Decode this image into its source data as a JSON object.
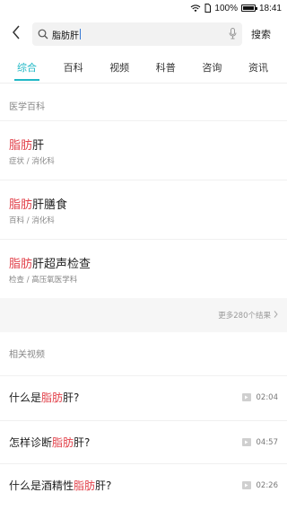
{
  "status_bar": {
    "battery_percent": "100%",
    "time": "18:41",
    "wifi_icon": "wifi-icon",
    "sim_icon": "sim-icon",
    "battery_level": 1.0
  },
  "search": {
    "value_highlight": "脂肪",
    "value_rest": "肝",
    "action_label": "搜索",
    "icons": [
      "back-arrow-icon",
      "search-icon",
      "microphone-icon"
    ]
  },
  "tabs": [
    {
      "label": "综合",
      "active": true
    },
    {
      "label": "百科",
      "active": false
    },
    {
      "label": "视频",
      "active": false
    },
    {
      "label": "科普",
      "active": false
    },
    {
      "label": "咨询",
      "active": false
    },
    {
      "label": "资讯",
      "active": false
    }
  ],
  "encyclopedia": {
    "header": "医学百科",
    "results": [
      {
        "title_highlight": "脂肪",
        "title_rest": "肝",
        "subtitle": "症状 / 消化科"
      },
      {
        "title_highlight": "脂肪",
        "title_rest": "肝膳食",
        "subtitle": "百科 / 消化科"
      },
      {
        "title_highlight": "脂肪",
        "title_rest": "肝超声检查",
        "subtitle": "检查 / 高压氧医学科"
      }
    ],
    "more_label": "更多280个结果"
  },
  "videos": {
    "header": "相关视频",
    "items": [
      {
        "prefix": "什么是",
        "highlight": "脂肪",
        "suffix": "肝?",
        "duration": "02:04"
      },
      {
        "prefix": "怎样诊断",
        "highlight": "脂肪",
        "suffix": "肝?",
        "duration": "04:57"
      },
      {
        "prefix": "什么是酒精性",
        "highlight": "脂肪",
        "suffix": "肝?",
        "duration": "02:26"
      }
    ]
  },
  "colors": {
    "accent": "#21b8c6",
    "highlight": "#e2424b",
    "muted": "#888888"
  }
}
